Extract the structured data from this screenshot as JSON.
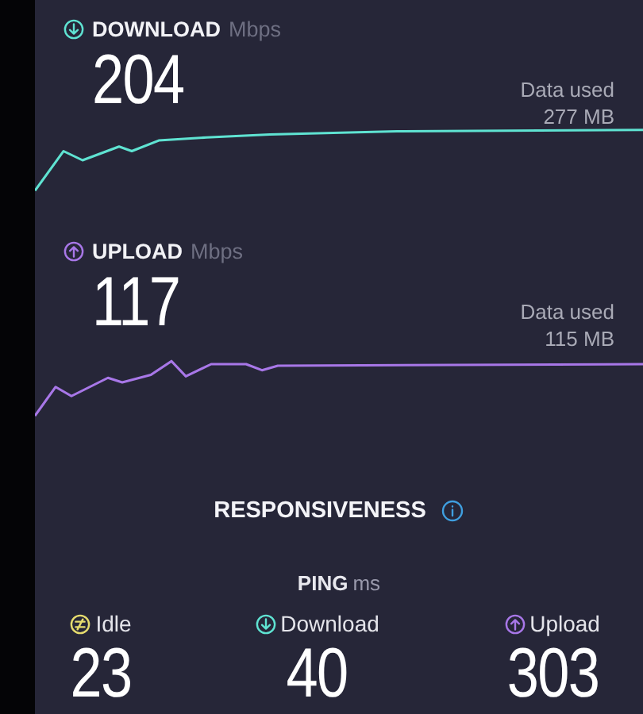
{
  "tests": [
    {
      "kind": "download",
      "label": "DOWNLOAD",
      "unit": "Mbps",
      "value": "204",
      "data_label": "Data used",
      "data_value": "277 MB",
      "color": "#5fe3d2"
    },
    {
      "kind": "upload",
      "label": "UPLOAD",
      "unit": "Mbps",
      "value": "117",
      "data_label": "Data used",
      "data_value": "115 MB",
      "color": "#a877e8"
    }
  ],
  "responsiveness": {
    "title": "RESPONSIVENESS"
  },
  "ping": {
    "label": "PING",
    "unit": "ms",
    "items": [
      {
        "kind": "idle",
        "label": "Idle",
        "value": "23",
        "color": "#e6dc6e"
      },
      {
        "kind": "download",
        "label": "Download",
        "value": "40",
        "color": "#5fe3d2"
      },
      {
        "kind": "upload",
        "label": "Upload",
        "value": "303",
        "color": "#a877e8"
      }
    ]
  }
}
